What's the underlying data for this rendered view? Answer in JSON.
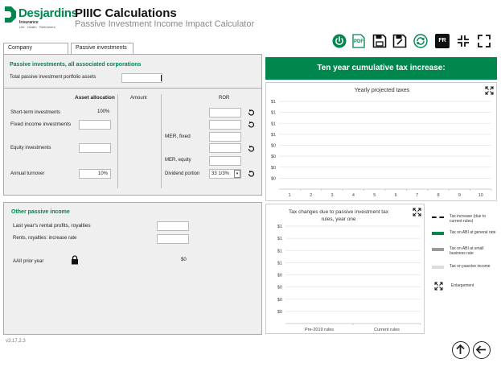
{
  "brand": {
    "name": "Desjardins",
    "line1": "Insurance",
    "line2": "Life · Health · Retirement",
    "color": "#00874e"
  },
  "app": {
    "title": "PIIIC Calculations",
    "subtitle": "Passive Investment Income Impact Calculator",
    "version": "v3.17.2.3"
  },
  "toolbar": {
    "icons": [
      "power-icon",
      "pdf-icon",
      "save-icon",
      "save-as-icon",
      "refresh-icon",
      "french-icon",
      "collapse-icon",
      "expand-icon"
    ],
    "pdf_label": "PDF",
    "fr_label": "FR"
  },
  "tabs": [
    {
      "label": "Company",
      "active": false
    },
    {
      "label": "Passive investments",
      "active": true
    }
  ],
  "passive": {
    "title": "Passive investments, all associated corporations",
    "total_label": "Total passive investment portfolio assets",
    "total_value": "",
    "col_allocation": "Asset allocation",
    "col_amount": "Amount",
    "col_ror": "ROR",
    "short_term_label": "Short-term investments",
    "short_term_pct": "100%",
    "fixed_income_label": "Fixed income investments",
    "equity_label": "Equity investments",
    "turnover_label": "Annual turnover",
    "turnover_value": "10%",
    "mer_fixed_label": "MER, fixed",
    "mer_equity_label": "MER, equity",
    "dividend_label": "Dividend portion",
    "dividend_value": "33 1/3%"
  },
  "other": {
    "title": "Other passive income",
    "rental_label": "Last year's rental profits, royalties",
    "rate_label": "Rents, royalties: increase rate",
    "aaii_label": "AAII prior year",
    "aaii_value": "$0"
  },
  "banner": "Ten year cumulative tax increase:",
  "yearly_chart": {
    "title": "Yearly projected taxes",
    "y_ticks": [
      "$1",
      "$1",
      "$1",
      "$1",
      "$0",
      "$0",
      "$0",
      "$0"
    ],
    "x_ticks": [
      "1",
      "2",
      "3",
      "4",
      "5",
      "6",
      "7",
      "8",
      "9",
      "10"
    ]
  },
  "changes_chart": {
    "title": "Tax changes due to passive investment tax rules, year one",
    "y_ticks": [
      "$1",
      "$1",
      "$1",
      "$1",
      "$0",
      "$0",
      "$0",
      "$0"
    ],
    "x_ticks": [
      "Pre-2019 rules",
      "Current rules"
    ]
  },
  "legend": [
    {
      "text": "Tax increase (due to current rules)",
      "style": "dashed",
      "color": "#111111"
    },
    {
      "text": "Tax on ABI at general rate",
      "style": "solid",
      "color": "#00874e"
    },
    {
      "text": "Tax on ABI at small business rate",
      "style": "solid",
      "color": "#9a9a9a"
    },
    {
      "text": "Tax on passive income",
      "style": "solid",
      "color": "#dddddd"
    }
  ],
  "enlargement_label": "Enlargement",
  "chart_data": [
    {
      "type": "line",
      "title": "Yearly projected taxes",
      "categories": [
        "1",
        "2",
        "3",
        "4",
        "5",
        "6",
        "7",
        "8",
        "9",
        "10"
      ],
      "y_tick_labels": [
        "$1",
        "$1",
        "$1",
        "$1",
        "$0",
        "$0",
        "$0",
        "$0"
      ],
      "series": [],
      "grid": true
    },
    {
      "type": "bar",
      "title": "Tax changes due to passive investment tax rules, year one",
      "categories": [
        "Pre-2019 rules",
        "Current rules"
      ],
      "y_tick_labels": [
        "$1",
        "$1",
        "$1",
        "$1",
        "$0",
        "$0",
        "$0",
        "$0"
      ],
      "series": [],
      "grid": true,
      "legend": "right"
    }
  ]
}
